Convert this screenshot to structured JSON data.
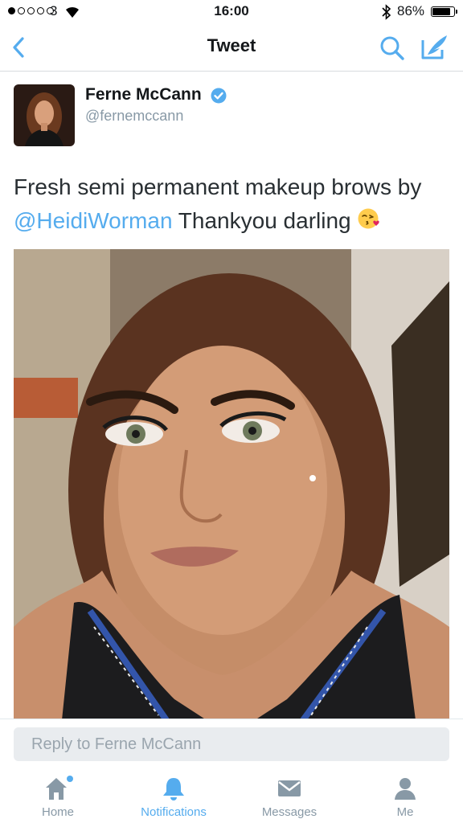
{
  "status_bar": {
    "carrier": "3",
    "signal_bars_filled": 1,
    "signal_bars_total": 5,
    "time": "16:00",
    "battery_percent": "86%",
    "battery_level": 0.86
  },
  "nav": {
    "title": "Tweet",
    "back_icon": "chevron-left-icon",
    "search_icon": "search-icon",
    "compose_icon": "compose-icon"
  },
  "tweet": {
    "author_name": "Ferne McCann",
    "author_handle": "@fernemccann",
    "verified": true,
    "text_before": "Fresh semi permanent makeup brows by ",
    "mention": "@HeidiWorman",
    "text_after": " Thankyou darling ",
    "emoji": "face-throwing-kiss"
  },
  "reply": {
    "placeholder": "Reply to Ferne McCann"
  },
  "tabs": [
    {
      "label": "Home",
      "icon": "home-icon",
      "active": false,
      "badge": true
    },
    {
      "label": "Notifications",
      "icon": "bell-icon",
      "active": true,
      "badge": false
    },
    {
      "label": "Messages",
      "icon": "envelope-icon",
      "active": false,
      "badge": false
    },
    {
      "label": "Me",
      "icon": "person-icon",
      "active": false,
      "badge": false
    }
  ],
  "colors": {
    "accent": "#55acee",
    "secondary_text": "#8899a6"
  }
}
